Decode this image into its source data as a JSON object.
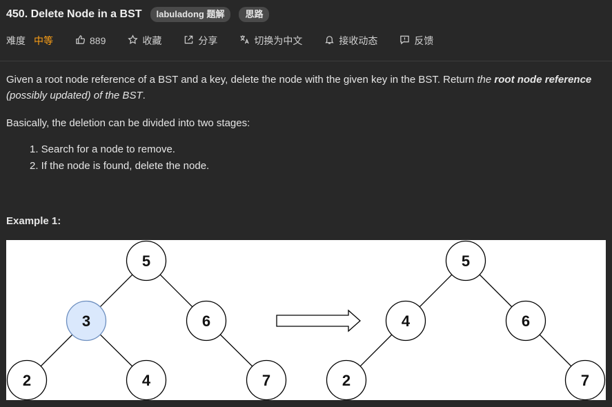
{
  "problem": {
    "title": "450. Delete Node in a BST",
    "tags": [
      "labuladong 题解",
      "思路"
    ]
  },
  "meta": {
    "difficulty_label": "难度",
    "difficulty_value": "中等",
    "likes": "889",
    "favorite": "收藏",
    "share": "分享",
    "translate": "切换为中文",
    "subscribe": "接收动态",
    "feedback": "反馈"
  },
  "description": {
    "p1_text": "Given a root node reference of a BST and a key, delete the node with the given key in the BST. Return ",
    "p1_em_a": "the ",
    "p1_em_strong": "root node reference",
    "p1_em_b": " (possibly updated) of the BST",
    "p1_end": ".",
    "p2": "Basically, the deletion can be divided into two stages:",
    "steps": [
      "1. Search for a node to remove.",
      "2. If the node is found, delete the node."
    ]
  },
  "example": {
    "title": "Example 1:",
    "before_nodes": [
      "5",
      "3",
      "6",
      "2",
      "4",
      "7"
    ],
    "after_nodes": [
      "5",
      "4",
      "6",
      "2",
      "7"
    ],
    "highlight_color": "#dae8fc",
    "highlight_border": "#6c8ebf"
  }
}
